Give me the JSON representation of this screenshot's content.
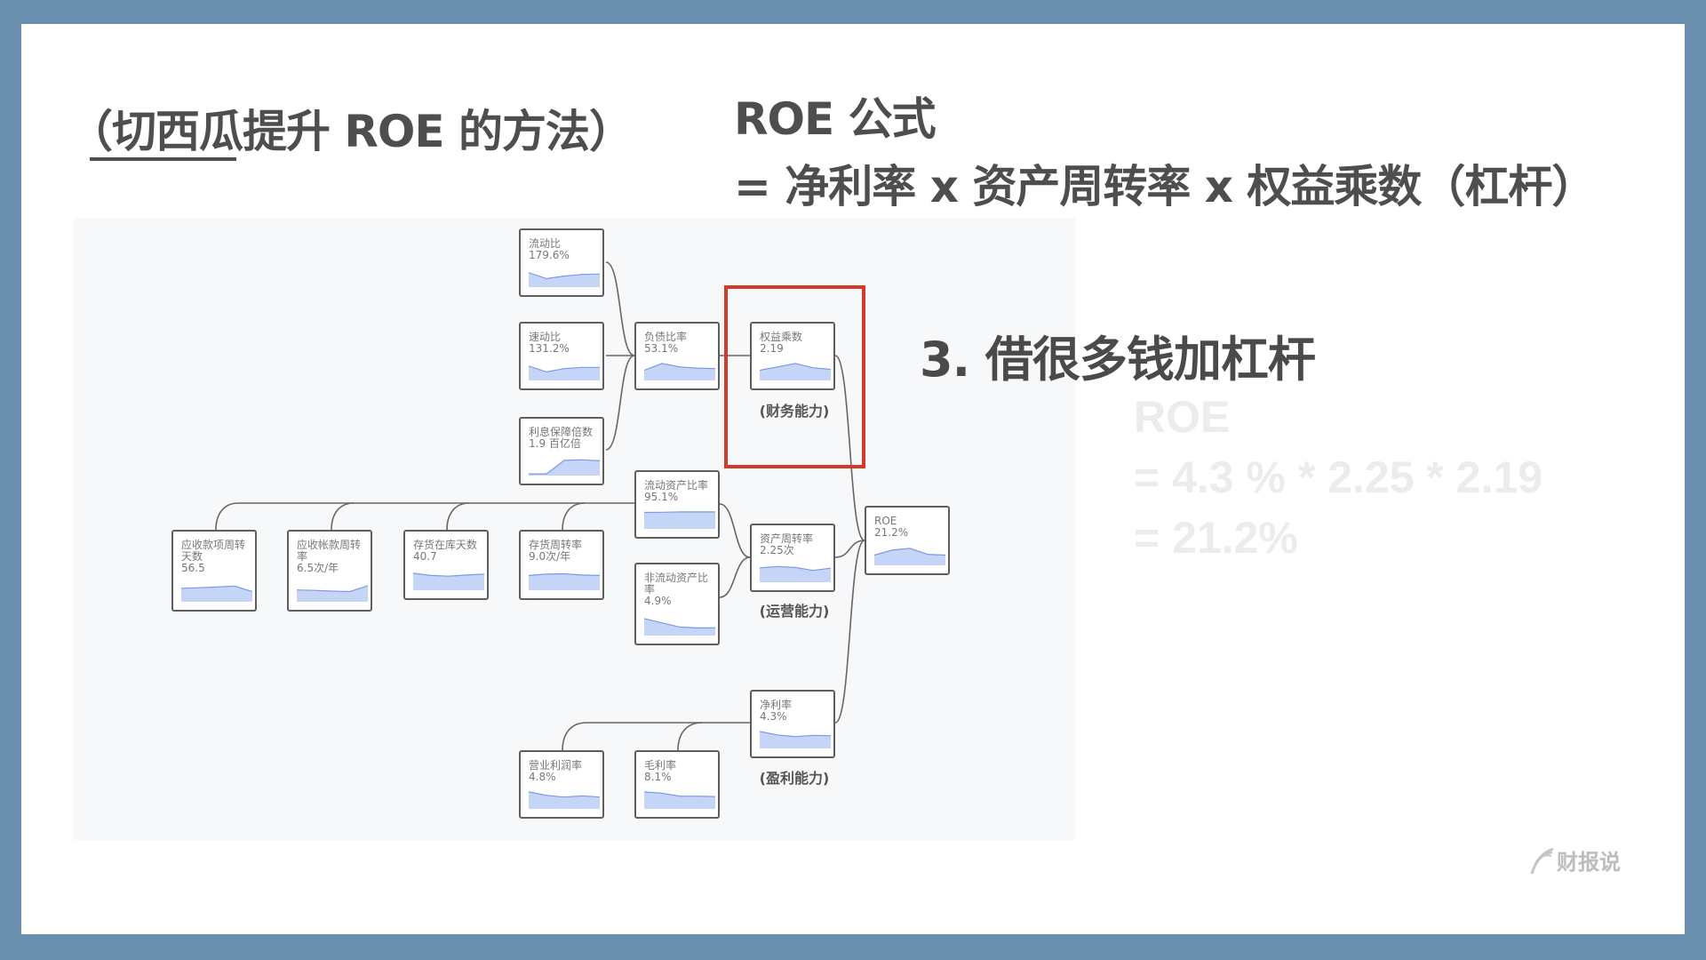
{
  "slide": {
    "title": "（切西瓜提升 ROE 的方法）",
    "formula_heading": "ROE 公式",
    "formula": "= 净利率 x 资产周转率 x 权益乘数（杠杆）",
    "point": "3. 借很多钱加杠杆",
    "calc": {
      "line1": "ROE",
      "line2": "= 4.3 % * 2.25 * 2.19",
      "line3": "= 21.2%"
    },
    "logo": "财报说",
    "colors": {
      "frame": "#6a8fae",
      "highlight": "#d23a2a",
      "spark_fill": "#c5d5f7",
      "spark_line": "#7b9ae6"
    }
  },
  "diagram": {
    "captions": {
      "finance": "(财务能力)",
      "operation": "(运营能力)",
      "profit": "(盈利能力)"
    },
    "nodes": [
      {
        "id": "current_ratio",
        "name": "流动比",
        "value": "179.6%",
        "trend": [
          0.8,
          0.45,
          0.6,
          0.7,
          0.72
        ]
      },
      {
        "id": "quick_ratio",
        "name": "速动比",
        "value": "131.2%",
        "trend": [
          0.8,
          0.45,
          0.65,
          0.72,
          0.72
        ]
      },
      {
        "id": "interest_coverage",
        "name": "利息保障倍数",
        "value": "1.9 百亿倍",
        "trend": [
          0.05,
          0.05,
          0.85,
          0.88,
          0.82
        ]
      },
      {
        "id": "debt_ratio",
        "name": "负债比率",
        "value": "53.1%",
        "trend": [
          0.55,
          0.95,
          0.75,
          0.68,
          0.65
        ]
      },
      {
        "id": "equity_multiplier",
        "name": "权益乘数",
        "value": "2.19",
        "trend": [
          0.55,
          0.75,
          0.95,
          0.7,
          0.6
        ]
      },
      {
        "id": "current_asset_ratio",
        "name": "流动资产比率",
        "value": "95.1%",
        "trend": [
          0.92,
          0.93,
          0.95,
          0.95,
          0.95
        ]
      },
      {
        "id": "receivable_days",
        "name": "应收款项周转天数",
        "value": "56.5",
        "trend": [
          0.75,
          0.78,
          0.82,
          0.88,
          0.55
        ]
      },
      {
        "id": "receivable_turnover",
        "name": "应收帐款周转率",
        "value": "6.5次/年",
        "trend": [
          0.65,
          0.62,
          0.58,
          0.55,
          0.9
        ]
      },
      {
        "id": "inventory_days",
        "name": "存货在库天数",
        "value": "40.7",
        "trend": [
          0.95,
          0.82,
          0.78,
          0.85,
          0.9
        ]
      },
      {
        "id": "inventory_turnover",
        "name": "存货周转率",
        "value": "9.0次/年",
        "trend": [
          0.82,
          0.9,
          0.92,
          0.85,
          0.82
        ]
      },
      {
        "id": "noncurrent_asset_ratio",
        "name": "非流动资产比率",
        "value": "4.9%",
        "trend": [
          0.95,
          0.7,
          0.45,
          0.4,
          0.4
        ]
      },
      {
        "id": "asset_turnover",
        "name": "资产周转率",
        "value": "2.25次",
        "trend": [
          0.8,
          0.88,
          0.82,
          0.65,
          0.78
        ]
      },
      {
        "id": "roe",
        "name": "ROE",
        "value": "21.2%",
        "trend": [
          0.55,
          0.85,
          0.95,
          0.6,
          0.55
        ]
      },
      {
        "id": "net_margin",
        "name": "净利率",
        "value": "4.3%",
        "trend": [
          0.95,
          0.75,
          0.65,
          0.72,
          0.7
        ]
      },
      {
        "id": "operating_margin",
        "name": "营业利润率",
        "value": "4.8%",
        "trend": [
          0.95,
          0.75,
          0.65,
          0.72,
          0.65
        ]
      },
      {
        "id": "gross_margin",
        "name": "毛利率",
        "value": "8.1%",
        "trend": [
          0.95,
          0.88,
          0.7,
          0.7,
          0.68
        ]
      }
    ]
  }
}
